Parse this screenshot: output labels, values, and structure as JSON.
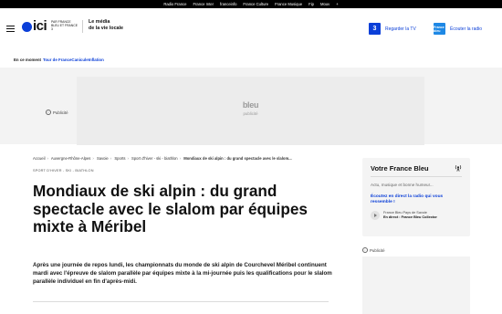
{
  "topnav": [
    "Radio France",
    "France Inter",
    "franceinfo",
    "France Culture",
    "France Musique",
    "Fip",
    "Mouv",
    "+"
  ],
  "header": {
    "logo_text": "ici",
    "logo_sub": "PAR FRANCE BLEU ET FRANCE 3",
    "tagline_1": "Le média",
    "tagline_2": "de la vie locale",
    "tv_logo": "3",
    "tv_label": "Regarder la TV",
    "radio_logo": "France bleu",
    "radio_label": "Écouter la radio"
  },
  "moment": {
    "label": "En ce moment",
    "links": [
      "Tour de France",
      "Canicule",
      "Inflation"
    ]
  },
  "ads": {
    "publicite": "Publicité",
    "ad_logo": "bleu",
    "ad_text": "publicité"
  },
  "breadcrumb": [
    "Accueil",
    "Auvergne-Rhône-Alpes",
    "Savoie",
    "Sports",
    "Sport d'hiver - ski - biathlon",
    "Mondiaux de ski alpin : du grand spectacle avec le slalom..."
  ],
  "article": {
    "rubric": "SPORT D'HIVER - SKI - BIATHLON",
    "title": "Mondiaux de ski alpin : du grand spectacle avec le slalom par équipes mixte à Méribel",
    "lead": "Après une journée de repos lundi, les championnats du monde de ski alpin de Courchevel Méribel continuent mardi avec l'épreuve de slalom parallèle par équipes mixte à la mi-journée puis les qualifications pour le slalom parallèle individuel en fin d'après-midi."
  },
  "sidebar": {
    "title": "Votre France Bleu",
    "desc": "Actu, musique et bonne humeur... ",
    "listen": "Écoutez en direct la radio qui vous ressemble !",
    "station": "France Bleu Pays de Savoie",
    "now_playing": "En direct : France Bleu Collector"
  },
  "colors": {
    "brand_blue": "#0b3fd8",
    "top_bar": "#000000"
  }
}
